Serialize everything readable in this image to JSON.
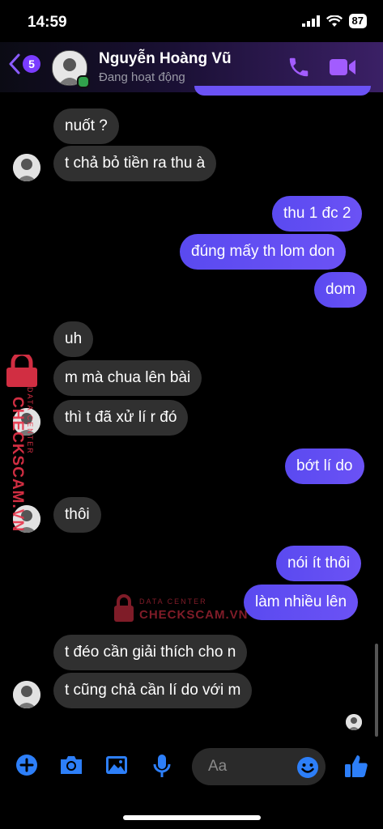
{
  "status_bar": {
    "time": "14:59",
    "battery": "87"
  },
  "header": {
    "back_count": "5",
    "contact_name": "Nguyễn Hoàng Vũ",
    "contact_status": "Đang hoạt động"
  },
  "messages": [
    {
      "text": "nuốt ?",
      "direction": "incoming"
    },
    {
      "text": "t chả bỏ tiền ra thu à",
      "direction": "incoming"
    },
    {
      "text": "thu 1 đc 2",
      "direction": "outgoing"
    },
    {
      "text": "đúng mấy th lom don",
      "direction": "outgoing"
    },
    {
      "text": "dom",
      "direction": "outgoing"
    },
    {
      "text": "uh",
      "direction": "incoming"
    },
    {
      "text": "m mà chua lên bài",
      "direction": "incoming"
    },
    {
      "text": "thì t đã xử lí r đó",
      "direction": "incoming"
    },
    {
      "text": "bớt lí do",
      "direction": "outgoing"
    },
    {
      "text": "thôi",
      "direction": "incoming"
    },
    {
      "text": "nói ít thôi",
      "direction": "outgoing"
    },
    {
      "text": "làm nhiều lên",
      "direction": "outgoing"
    },
    {
      "text": "t đéo cần giải thích cho n",
      "direction": "incoming"
    },
    {
      "text": "t cũng chả cần lí do với m",
      "direction": "incoming"
    }
  ],
  "watermark": {
    "brand": "CHECKSCAM.VN",
    "sub": "DATA CENTER"
  },
  "composer": {
    "placeholder": "Aa"
  },
  "icons": {
    "back": "chevron-left-icon",
    "call": "phone-icon",
    "video": "video-camera-icon",
    "add": "plus-circle-icon",
    "camera": "camera-icon",
    "gallery": "image-icon",
    "mic": "microphone-icon",
    "emoji": "emoji-icon",
    "like": "thumbs-up-icon"
  },
  "colors": {
    "accent": "#7a3cff",
    "outgoing_bubble": "#5f4cf2",
    "incoming_bubble": "#303030",
    "composer_icon": "#2d7ff9",
    "watermark": "#e8334a"
  }
}
